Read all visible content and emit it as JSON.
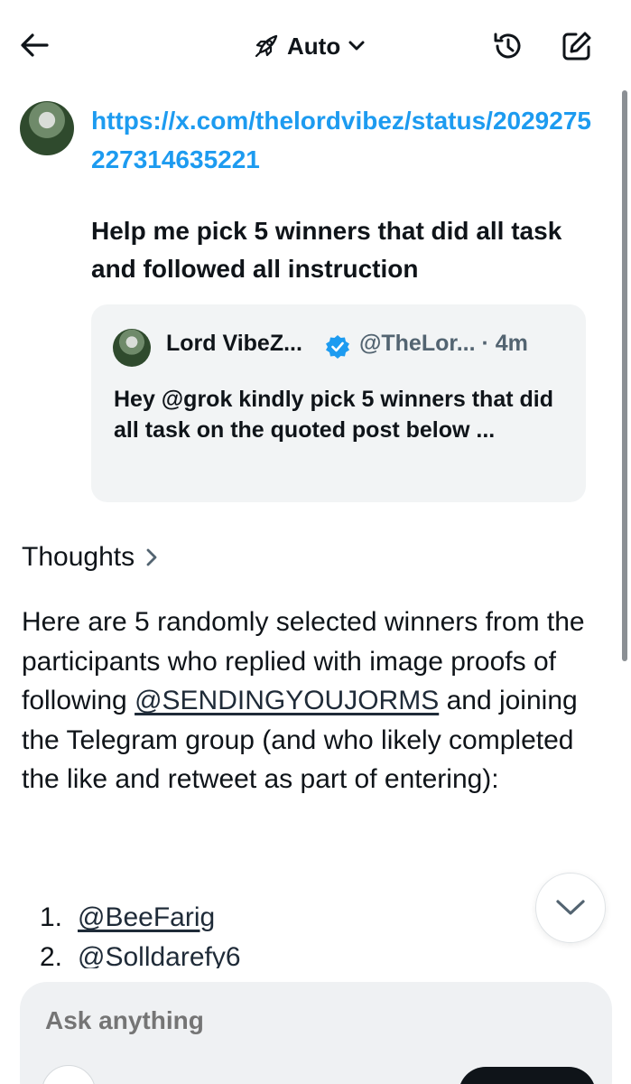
{
  "header": {
    "mode_label": "Auto",
    "icons": [
      "back-arrow-icon",
      "rocket-icon",
      "chevron-down-icon",
      "history-icon",
      "compose-icon"
    ]
  },
  "user_message": {
    "link": "https://x.com/thelordvibez/status/2029275227314635221",
    "text": "Help me pick 5 winners that did all task and followed all instruction"
  },
  "quoted_post": {
    "author_name": "Lord VibeZ...",
    "handle_time": "@TheLor... · 4m",
    "body": "Hey @grok kindly pick 5 winners that did all task on the quoted post below ..."
  },
  "thoughts_label": "Thoughts",
  "answer": {
    "intro_part1": "Here are 5 randomly selected winners from the participants who replied with image proofs of following ",
    "mention": "@SENDINGYOUJORMS",
    "intro_part2": " and joining the Telegram group (and who likely completed the like and retweet as part of entering):",
    "winners": [
      {
        "num": "1.",
        "handle": "@BeeFarig"
      },
      {
        "num": "2.",
        "handle": "@Solldarefy6"
      }
    ]
  },
  "composer": {
    "placeholder": "Ask anything"
  },
  "colors": {
    "link": "#1d9bf0",
    "text": "#0f1419",
    "muted": "#536471",
    "card_bg": "#f2f4f5",
    "composer_bg": "#eff1f3"
  }
}
